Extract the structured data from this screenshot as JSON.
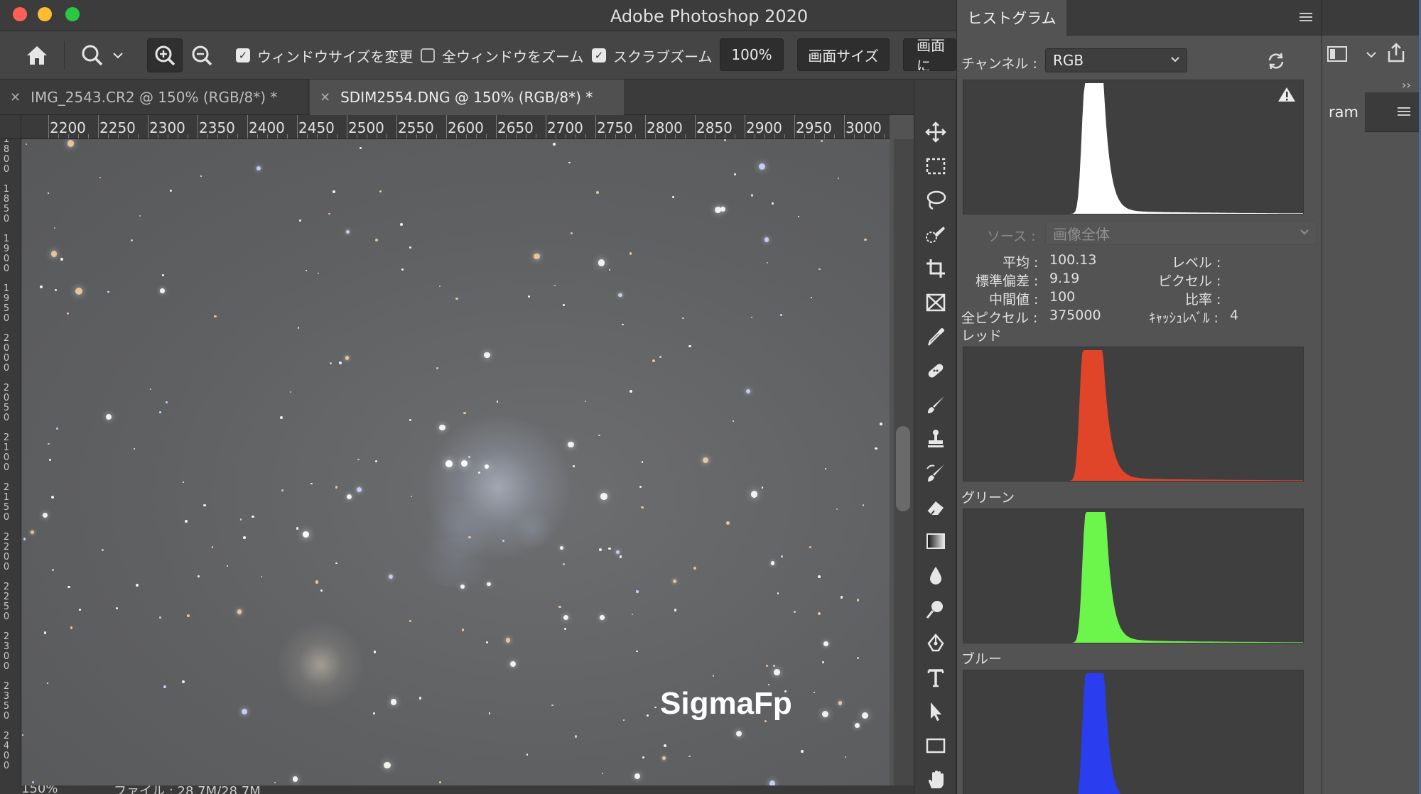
{
  "window": {
    "title": "Adobe Photoshop 2020"
  },
  "options_bar": {
    "resize_windows_label": "ウィンドウサイズを変更",
    "resize_windows_checked": true,
    "zoom_all_label": "全ウィンドウをズーム",
    "zoom_all_checked": false,
    "scrubby_zoom_label": "スクラブズーム",
    "scrubby_zoom_checked": true,
    "zoom_100_label": "100%",
    "fit_screen_label": "画面サイズ",
    "fill_screen_label": "画面に"
  },
  "tabs": [
    {
      "label": "IMG_2543.CR2 @ 150% (RGB/8*) *",
      "active": false
    },
    {
      "label": "SDIM2554.DNG @ 150% (RGB/8*) *",
      "active": true
    }
  ],
  "ruler_top": [
    "2200",
    "2250",
    "2300",
    "2350",
    "2400",
    "2450",
    "2500",
    "2550",
    "2600",
    "2650",
    "2700",
    "2750",
    "2800",
    "2850",
    "2900",
    "2950",
    "3000"
  ],
  "ruler_left": [
    "1800",
    "1850",
    "1900",
    "1950",
    "2000",
    "2050",
    "2100",
    "2150",
    "2200",
    "2250",
    "2300",
    "2350",
    "2400"
  ],
  "canvas": {
    "watermark": "SigmaFp"
  },
  "status_bar": {
    "zoom": "150%",
    "doc_info": "ファイル : 28.7M/28.7M"
  },
  "tools": [
    {
      "name": "move-tool-icon"
    },
    {
      "name": "marquee-tool-icon"
    },
    {
      "name": "lasso-tool-icon"
    },
    {
      "name": "quick-selection-tool-icon"
    },
    {
      "name": "crop-tool-icon"
    },
    {
      "name": "frame-tool-icon"
    },
    {
      "name": "eyedropper-tool-icon"
    },
    {
      "name": "healing-brush-tool-icon"
    },
    {
      "name": "brush-tool-icon"
    },
    {
      "name": "clone-stamp-tool-icon"
    },
    {
      "name": "history-brush-tool-icon"
    },
    {
      "name": "eraser-tool-icon"
    },
    {
      "name": "gradient-tool-icon"
    },
    {
      "name": "blur-tool-icon"
    },
    {
      "name": "dodge-tool-icon"
    },
    {
      "name": "pen-tool-icon"
    },
    {
      "name": "type-tool-icon"
    },
    {
      "name": "path-selection-tool-icon"
    },
    {
      "name": "rectangle-tool-icon"
    },
    {
      "name": "hand-tool-icon"
    }
  ],
  "histogram_panel": {
    "tab_label": "ヒストグラム",
    "channel_label": "チャンネル :",
    "channel_value": "RGB",
    "source_label": "ソース :",
    "source_value": "画像全体",
    "stats": {
      "mean_label": "平均 :",
      "mean_value": "100.13",
      "std_label": "標準偏差 :",
      "std_value": "9.19",
      "median_label": "中間値 :",
      "median_value": "100",
      "pixels_label": "全ピクセル :",
      "pixels_value": "375000",
      "level_label": "レベル :",
      "count_label": "ピクセル :",
      "percentile_label": "比率 :",
      "cache_label": "ｷｬｯｼｭﾚﾍﾞﾙ :",
      "cache_value": "4"
    },
    "channels": [
      {
        "label": "レッド",
        "color": "#e0452a"
      },
      {
        "label": "グリーン",
        "color": "#6cf54a"
      },
      {
        "label": "ブルー",
        "color": "#2a3ef0"
      }
    ],
    "composite_color": "#ffffff"
  },
  "right_dock": {
    "tab_label": "ram"
  }
}
